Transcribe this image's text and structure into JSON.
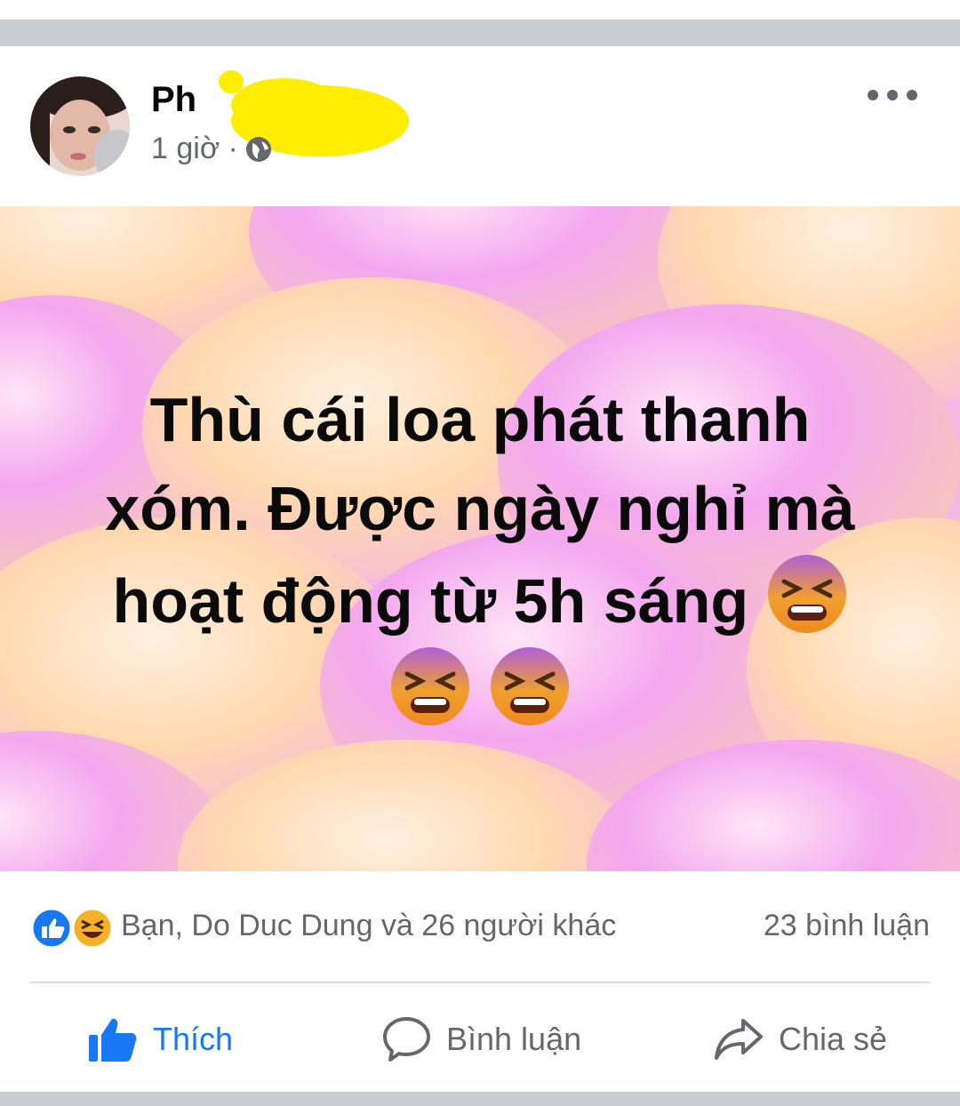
{
  "post": {
    "author": "Ph",
    "time": "1 giờ ·",
    "text_lines": [
      "Thù cái loa phát thanh",
      "xóm. Được ngày nghỉ mà",
      "hoạt động từ 5h sáng"
    ],
    "emoji": "tired-face-emoji",
    "emoji_count": 3
  },
  "reactions": {
    "icons": [
      "like-reaction-icon",
      "haha-reaction-icon"
    ],
    "text": "Bạn, Do Duc Dung và 26 người khác",
    "comments": "23 bình luận"
  },
  "actions": {
    "like": "Thích",
    "comment": "Bình luận",
    "share": "Chia sẻ"
  },
  "colors": {
    "accent": "#1877f2",
    "secondary_text": "#65676b",
    "separator": "#c9ccd1",
    "background_pink": "#f2a6f2",
    "background_peach": "#ffd9b0"
  }
}
